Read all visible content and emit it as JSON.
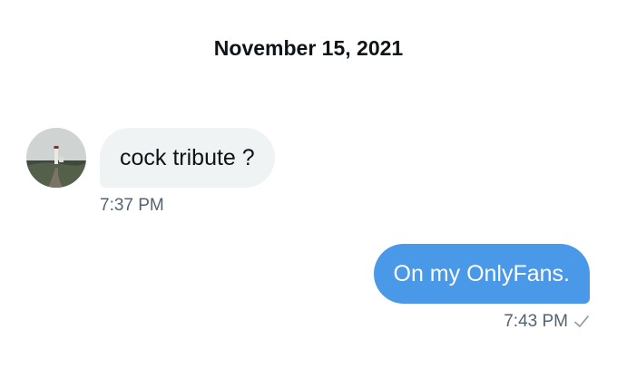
{
  "conversation": {
    "date": "November 15, 2021",
    "messages": [
      {
        "direction": "incoming",
        "text": "cock tribute ?",
        "time": "7:37 PM"
      },
      {
        "direction": "outgoing",
        "text": "On my OnlyFans.",
        "time": "7:43 PM",
        "status_icon": "check-icon"
      }
    ]
  },
  "colors": {
    "incoming_bubble": "#eff3f4",
    "outgoing_bubble": "#4a99e9",
    "timestamp": "#536471"
  }
}
